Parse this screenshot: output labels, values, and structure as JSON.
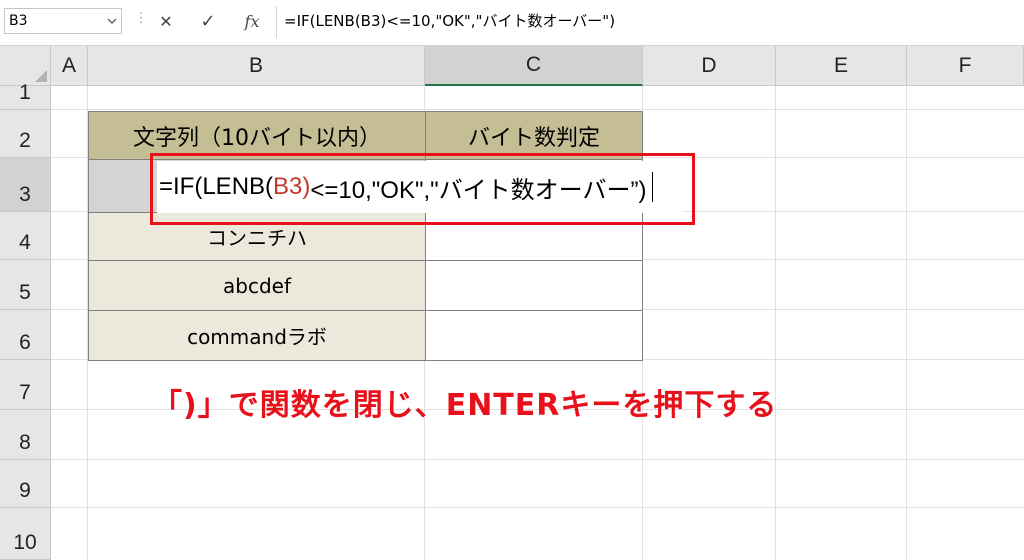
{
  "formula_bar": {
    "name_box": "B3",
    "cancel_glyph": "✕",
    "enter_glyph": "✓",
    "function_glyph": "fx",
    "formula": "=IF(LENB(B3)<=10,\"OK\",\"バイト数オーバー\")"
  },
  "columns": [
    "A",
    "B",
    "C",
    "D",
    "E",
    "F"
  ],
  "rows": [
    "1",
    "2",
    "3",
    "4",
    "5",
    "6",
    "7",
    "8",
    "9",
    "10"
  ],
  "table": {
    "header_b": "文字列（10バイト以内）",
    "header_c": "バイト数判定",
    "b4": "コンニチハ",
    "b5": "abcdef",
    "b6": "commandラボ"
  },
  "editing": {
    "prefix": "=IF(LENB(",
    "ref": "B3",
    "close_ref": ")",
    "suffix": "<=10,\"OK\",\"バイト数オーバー”)"
  },
  "annotation": "「)」で関数を閉じ、ENTERキーを押下する",
  "colors": {
    "accent_red": "#e8111b",
    "header_fill": "#c5bd93",
    "data_fill": "#ece8db",
    "excel_green": "#217346"
  }
}
